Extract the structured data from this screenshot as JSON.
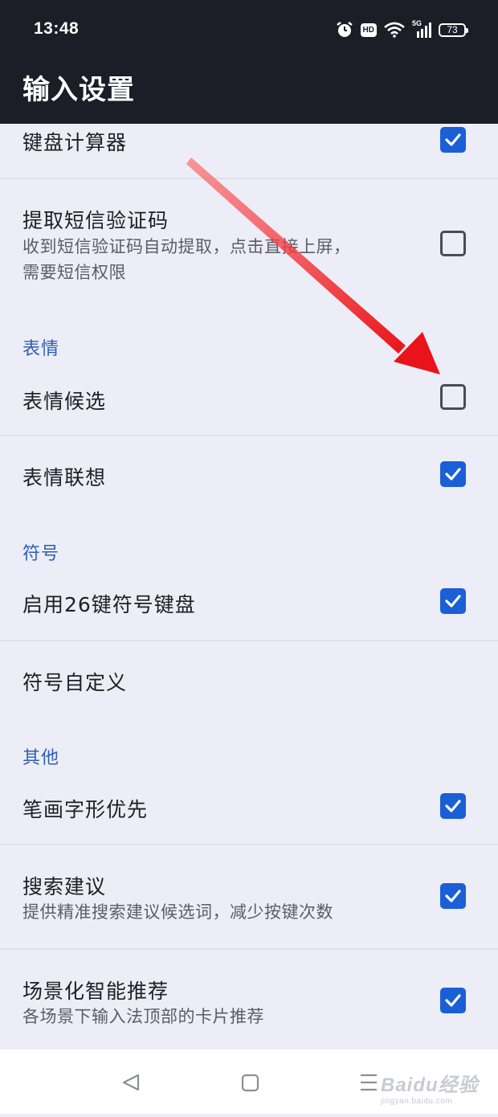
{
  "status_bar": {
    "time": "13:48",
    "icons": [
      "alarm-icon",
      "hd-icon",
      "wifi-icon",
      "signal-5g-icon",
      "battery-icon"
    ],
    "hd_label": "HD",
    "network_label": "5G",
    "battery_level": "73"
  },
  "app_bar": {
    "title": "输入设置"
  },
  "settings": {
    "keyboard_calculator": {
      "label": "键盘计算器",
      "checked": true
    },
    "sms_code": {
      "label": "提取短信验证码",
      "sub_line1": "收到短信验证码自动提取，点击直接上屏，",
      "sub_line2": "需要短信权限",
      "checked": false
    },
    "section_emoji": "表情",
    "emoji_candidates": {
      "label": "表情候选",
      "checked": false
    },
    "emoji_association": {
      "label": "表情联想",
      "checked": true
    },
    "section_symbols": "符号",
    "symbol_keyboard_26": {
      "label": "启用26键符号键盘",
      "checked": true
    },
    "symbol_custom": {
      "label": "符号自定义"
    },
    "section_other": "其他",
    "stroke_priority": {
      "label": "笔画字形优先",
      "checked": true
    },
    "search_suggestions": {
      "label": "搜索建议",
      "sub": "提供精准搜索建议候选词，减少按键次数",
      "checked": true
    },
    "scene_recommend": {
      "label": "场景化智能推荐",
      "sub": "各场景下输入法顶部的卡片推荐",
      "checked": true
    }
  },
  "nav_bar": {
    "items": [
      "back-icon",
      "home-icon",
      "menu-icon"
    ]
  },
  "watermark": {
    "brand": "Baidu经验",
    "url": "jingyan.baidu.com"
  },
  "colors": {
    "accent": "#1a5fd6",
    "section": "#2f5fb3",
    "header_bg": "#1b1d27",
    "page_bg": "#ecedf7",
    "annotation_arrow": "#e8141a"
  }
}
